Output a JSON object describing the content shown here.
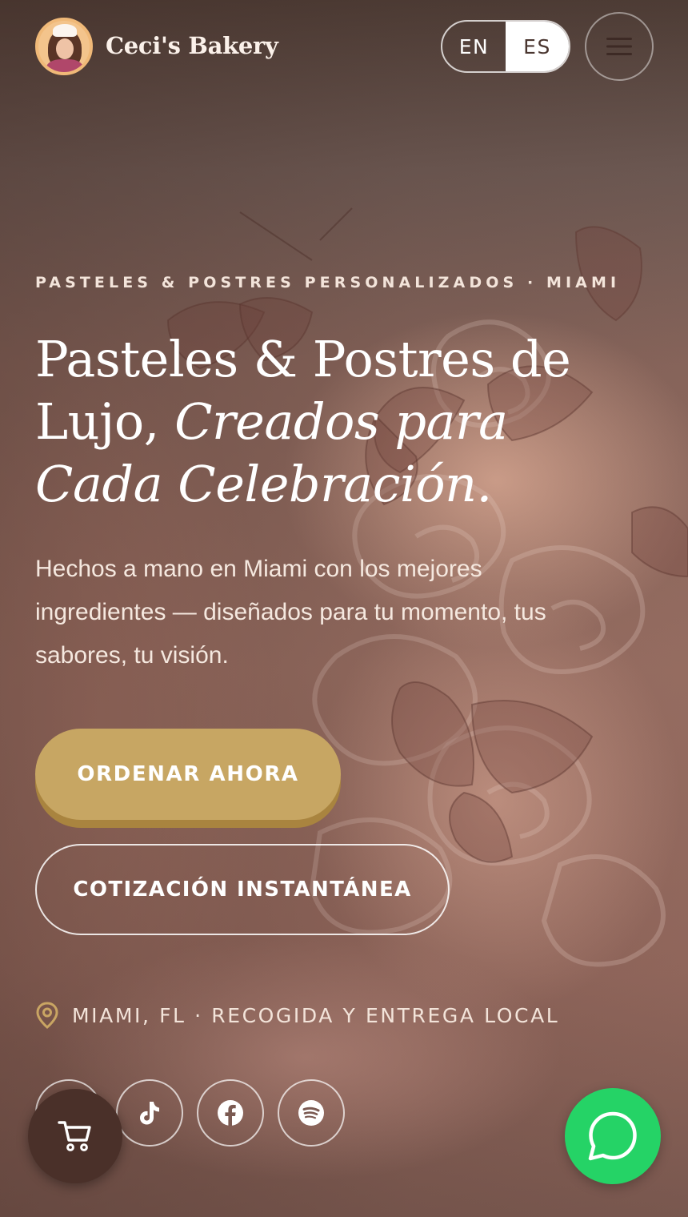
{
  "header": {
    "brand_name": "Ceci's Bakery",
    "logo_icon": "baker-avatar-logo",
    "language_toggle": {
      "options": [
        "EN",
        "ES"
      ],
      "selected": "ES"
    },
    "menu_icon": "hamburger-menu-icon"
  },
  "hero": {
    "eyebrow": "PASTELES & POSTRES PERSONALIZADOS · MIAMI",
    "title_line1": "Pasteles & Postres de",
    "title_lujo": "Lujo,",
    "title_italic": "Creados para Cada Celebración.",
    "subtitle": "Hechos a mano en Miami con los mejores ingredientes — diseñados para tu momento, tus sabores, tu visión.",
    "primary_cta": "ORDENAR AHORA",
    "secondary_cta": "COTIZACIÓN INSTANTÁNEA",
    "location_text": "MIAMI, FL · RECOGIDA Y ENTREGA LOCAL",
    "location_icon": "map-pin-icon"
  },
  "social_icons": [
    "instagram-icon",
    "tiktok-icon",
    "facebook-icon",
    "spotify-icon"
  ],
  "floating": {
    "cart_icon": "shopping-cart-icon",
    "chat_icon": "whatsapp-icon"
  },
  "colors": {
    "gold_button": "#c7a663",
    "gold_button_shadow": "#a9843f",
    "cart_button": "#4a3029",
    "whatsapp_green": "#25d366",
    "text_light": "#f7ede6"
  }
}
